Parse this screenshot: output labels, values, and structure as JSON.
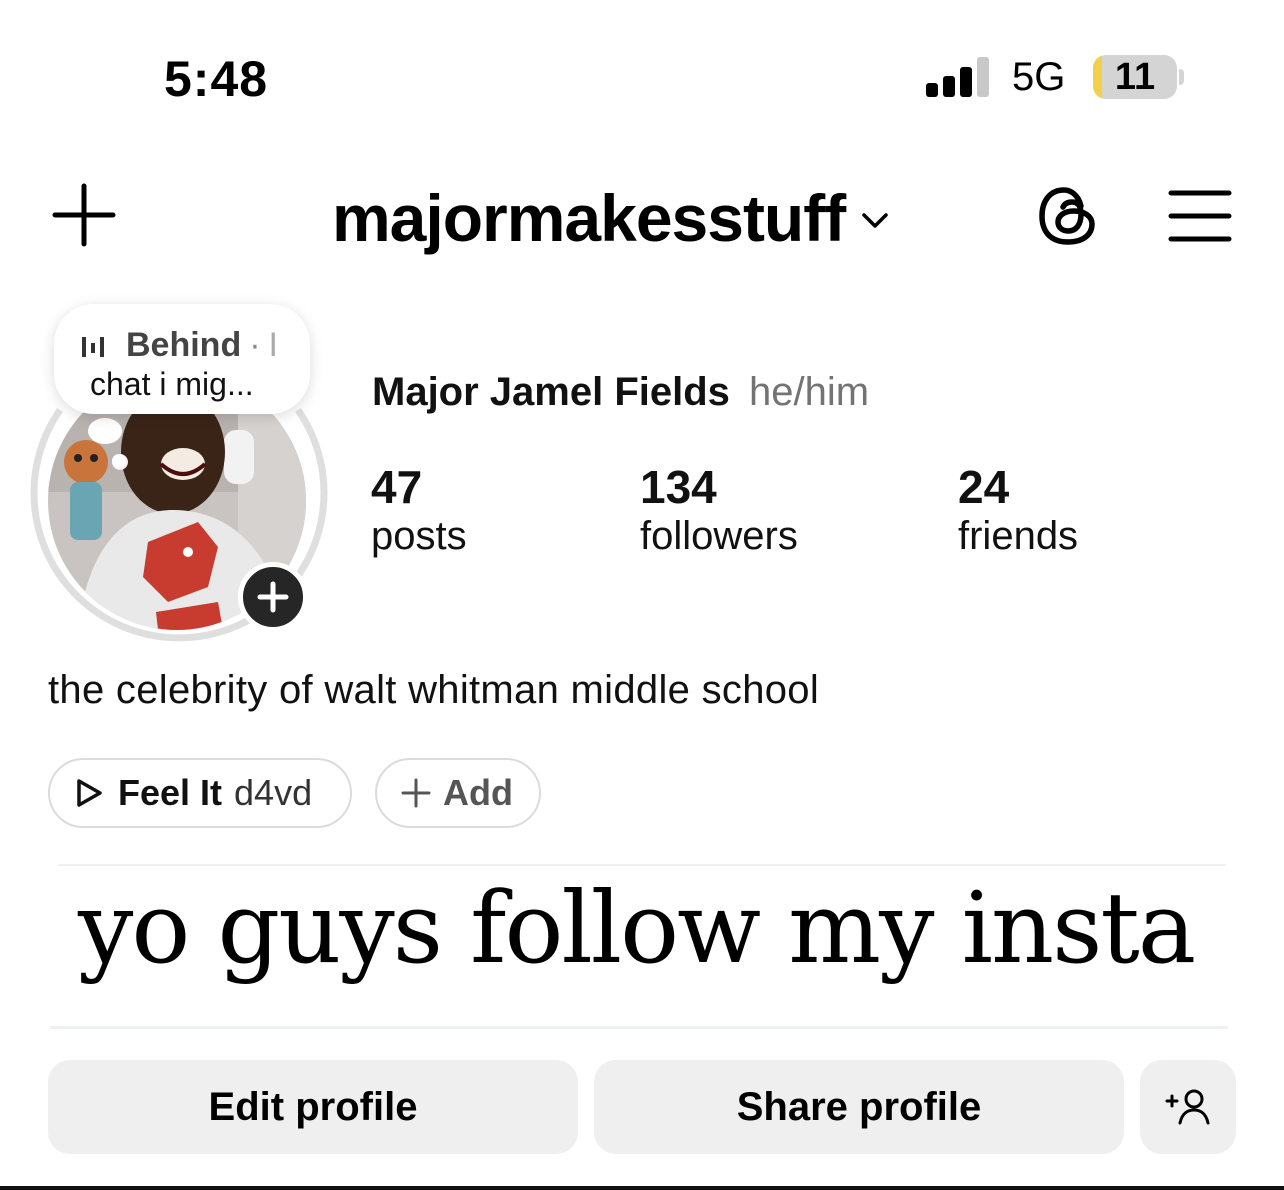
{
  "status_bar": {
    "time": "5:48",
    "network": "5G",
    "battery": "11",
    "battery_level": 0.11
  },
  "header": {
    "username": "majormakesstuff"
  },
  "note": {
    "title": "Behind",
    "extra": "I",
    "text": "chat i mig..."
  },
  "profile": {
    "name": "Major Jamel Fields",
    "pronouns": "he/him",
    "bio": "the celebrity of walt whitman middle school",
    "stats": [
      {
        "value": "47",
        "label": "posts"
      },
      {
        "value": "134",
        "label": "followers"
      },
      {
        "value": "24",
        "label": "friends"
      }
    ]
  },
  "music": {
    "song": "Feel It",
    "artist": "d4vd",
    "add_label": "Add"
  },
  "banner": {
    "text": "yo guys follow my insta"
  },
  "actions": {
    "edit": "Edit profile",
    "share": "Share profile"
  },
  "colors": {
    "button_bg": "#efefef",
    "muted_text": "#737373",
    "battery_fill": "#f2d04b"
  }
}
